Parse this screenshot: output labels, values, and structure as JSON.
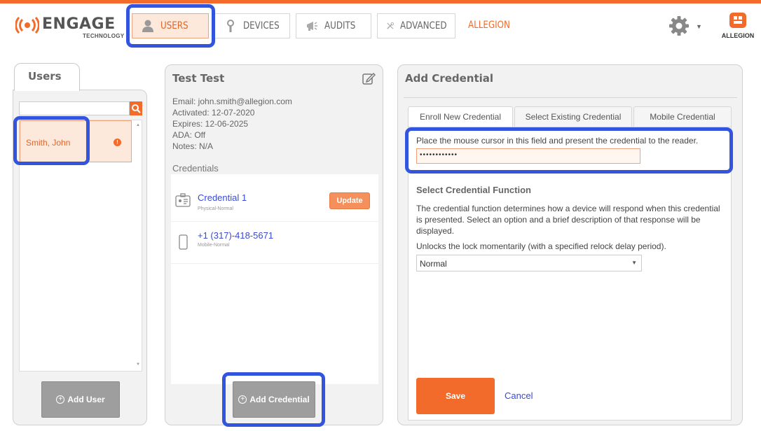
{
  "header": {
    "logo_text": "ENGAGE",
    "logo_sub": "TECHNOLOGY",
    "nav": [
      {
        "label": "USERS",
        "icon": "user-icon",
        "active": true
      },
      {
        "label": "DEVICES",
        "icon": "lock-device-icon",
        "active": false
      },
      {
        "label": "AUDITS",
        "icon": "megaphone-icon",
        "active": false
      },
      {
        "label": "ADVANCED",
        "icon": "tools-icon",
        "active": false
      }
    ],
    "allegion_link": "ALLEGION",
    "brand_text": "ALLEGION"
  },
  "users_panel": {
    "tab_label": "Users",
    "search_value": "",
    "users": [
      {
        "name": "Smith, John",
        "alert": "!"
      }
    ],
    "add_user_label": "Add User"
  },
  "detail_panel": {
    "title": "Test Test",
    "email": "Email: john.smith@allegion.com",
    "activated": "Activated: 12-07-2020",
    "expires": "Expires: 12-06-2025",
    "ada": "ADA: Off",
    "notes": "Notes: N/A",
    "credentials_heading": "Credentials",
    "credentials": [
      {
        "title": "Credential 1",
        "subtitle": "Physical-Normal",
        "icon": "badge-icon",
        "action": "Update"
      },
      {
        "title": "+1 (317)-418-5671",
        "subtitle": "Mobile-Normal",
        "icon": "phone-icon",
        "action": ""
      }
    ],
    "add_credential_label": "Add Credential"
  },
  "add_credential": {
    "title": "Add Credential",
    "tabs": [
      "Enroll New Credential",
      "Select Existing Credential",
      "Mobile Credential"
    ],
    "active_tab": 0,
    "instruction": "Place the mouse cursor in this field and present the credential to the reader.",
    "credential_value": "••••••••••••",
    "function_title": "Select Credential Function",
    "function_desc": "The credential function determines how a device will respond when this credential is presented. Select an option and a brief description of that response will be displayed.",
    "selected_desc": "Unlocks the lock momentarily (with a specified relock delay period).",
    "function_value": "Normal",
    "save_label": "Save",
    "cancel_label": "Cancel"
  },
  "colors": {
    "accent": "#f26b2a",
    "highlight": "#3355dd",
    "link": "#3a4bd0"
  }
}
